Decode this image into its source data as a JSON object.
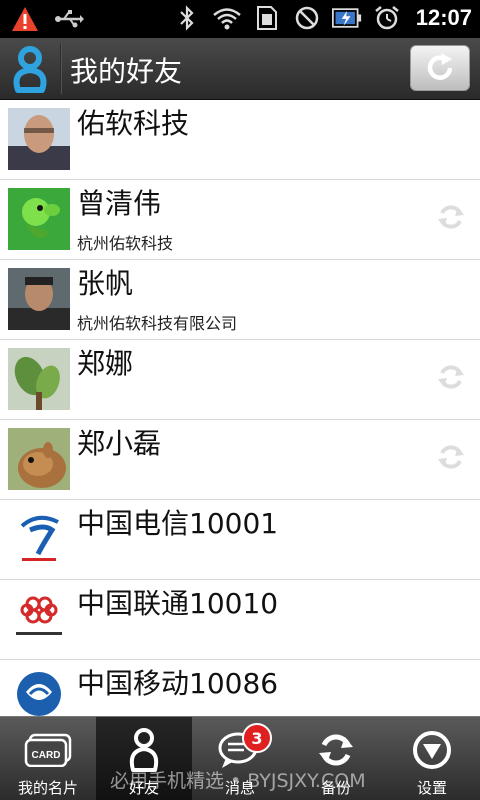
{
  "status": {
    "time": "12:07"
  },
  "header": {
    "title": "我的好友"
  },
  "contacts": [
    {
      "name": "佑软科技",
      "company": "",
      "avatar": "photo-man"
    },
    {
      "name": "曾清伟",
      "company": "杭州佑软科技",
      "avatar": "peashooter"
    },
    {
      "name": "张帆",
      "company": "杭州佑软科技有限公司",
      "avatar": "photo-man2"
    },
    {
      "name": "郑娜",
      "company": "",
      "avatar": "plant"
    },
    {
      "name": "郑小磊",
      "company": "",
      "avatar": "squirrel"
    },
    {
      "name": "中国电信10001",
      "company": "",
      "avatar": "china-telecom-logo"
    },
    {
      "name": "中国联通10010",
      "company": "",
      "avatar": "china-unicom-logo"
    },
    {
      "name": "中国移动10086",
      "company": "",
      "avatar": "china-mobile-logo"
    }
  ],
  "tabs": [
    {
      "label": "我的名片",
      "icon": "card-icon"
    },
    {
      "label": "好友",
      "icon": "friend-icon"
    },
    {
      "label": "消息",
      "icon": "message-icon",
      "badge": "3"
    },
    {
      "label": "备份",
      "icon": "backup-icon"
    },
    {
      "label": "设置",
      "icon": "settings-icon"
    }
  ],
  "watermark": "必用手机精选 • BYJSJXY.COM",
  "colors": {
    "accent": "#2ea3e0",
    "badge": "#e02020"
  }
}
